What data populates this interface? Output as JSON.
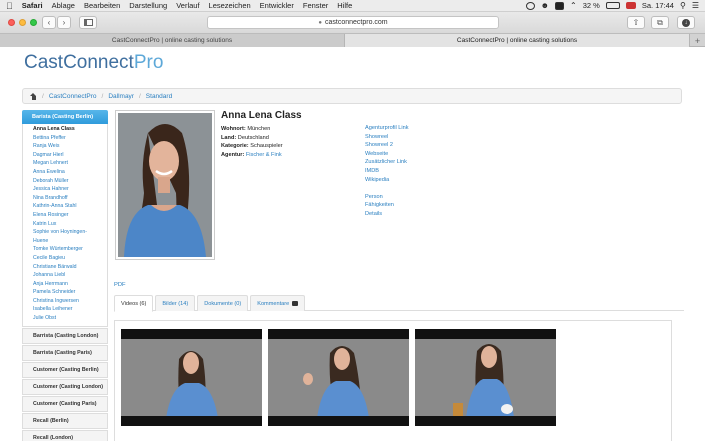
{
  "menubar": {
    "app": "Safari",
    "items": [
      "Ablage",
      "Bearbeiten",
      "Darstellung",
      "Verlauf",
      "Lesezeichen",
      "Entwickler",
      "Fenster",
      "Hilfe"
    ],
    "battery": "32 %",
    "time": "Sa. 17:44"
  },
  "browser": {
    "address": "castconnectpro.com",
    "tabs": [
      "CastConnectPro | online casting solutions",
      "CastConnectPro | online casting solutions"
    ]
  },
  "site": {
    "logo_main": "CastConnect",
    "logo_accent": "Pro",
    "breadcrumb": [
      "CastConnectPro",
      "Dallmayr",
      "Standard"
    ]
  },
  "sidebar": {
    "active_group": "Barista (Casting Berlin)",
    "people": [
      "Anna Lena Class",
      "Bettina Pfeffer",
      "Ranja Weis",
      "Dagmar Hierl",
      "Megan Lehnert",
      "Anna Ewelina",
      "Deborah Müller",
      "Jessica Hahner",
      "Nina Brandhoff",
      "Kathrin-Anna Stahl",
      "Elena Rosinger",
      "Katrin Lux",
      "Sophie von Hoyningen-",
      "Huene",
      "Tomke Würtemberger",
      "Cecile Bagieu",
      "Christiane Bärwald",
      "Johanna Liebl",
      "Anja Herrmann",
      "Pamela Schneider",
      "Christina Ingwersen",
      "Isabella Leihener",
      "Julie Obst"
    ],
    "groups": [
      "Barrista (Casting London)",
      "Barrista (Casting Paris)",
      "Customer (Casting Berlin)",
      "Customer (Casting London)",
      "Customer (Casting Paris)",
      "Recall (Berlin)",
      "Recall (London)"
    ]
  },
  "profile": {
    "name": "Anna Lena Class",
    "wohnort_label": "Wohnort:",
    "wohnort": "München",
    "land_label": "Land:",
    "land": "Deutschland",
    "kategorie_label": "Kategorie:",
    "kategorie": "Schauspieler",
    "agentur_label": "Agentur:",
    "agentur": "Fischer & Fink",
    "links": [
      "Agenturprofil Link",
      "Showreel",
      "Showreel 2",
      "Webseite",
      "Zusätzlicher Link",
      "IMDB",
      "Wikipedia"
    ],
    "links2": [
      "Person",
      "Fähigkeiten",
      "Details"
    ],
    "pdf": "PDF"
  },
  "media_tabs": {
    "videos": "Videos (6)",
    "bilder": "Bilder (14)",
    "dokumente": "Dokumente (0)",
    "kommentare": "Kommentare"
  }
}
